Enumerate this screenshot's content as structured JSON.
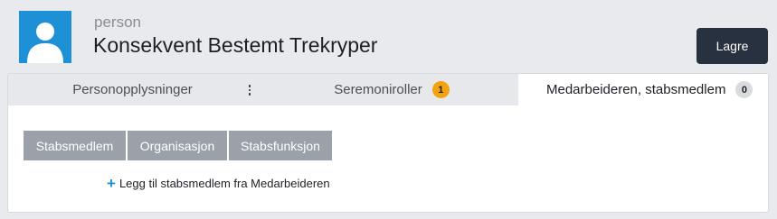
{
  "header": {
    "entity_type": "person",
    "entity_name": "Konsekvent Bestemt Trekryper",
    "save_label": "Lagre",
    "avatar_color": "#1e90d6"
  },
  "tabs": [
    {
      "label": "Personopplysninger",
      "active": false
    },
    {
      "label": "Seremoniroller",
      "badge": "1",
      "badge_color": "#f2a30f",
      "active": false
    },
    {
      "label": "Medarbeideren, stabsmedlem",
      "badge": "0",
      "active": true
    }
  ],
  "table": {
    "columns": [
      "Stabsmedlem",
      "Organisasjon",
      "Stabsfunksjon"
    ]
  },
  "add_link": {
    "icon": "plus-icon",
    "label": "Legg til stabsmedlem fra Medarbeideren"
  }
}
